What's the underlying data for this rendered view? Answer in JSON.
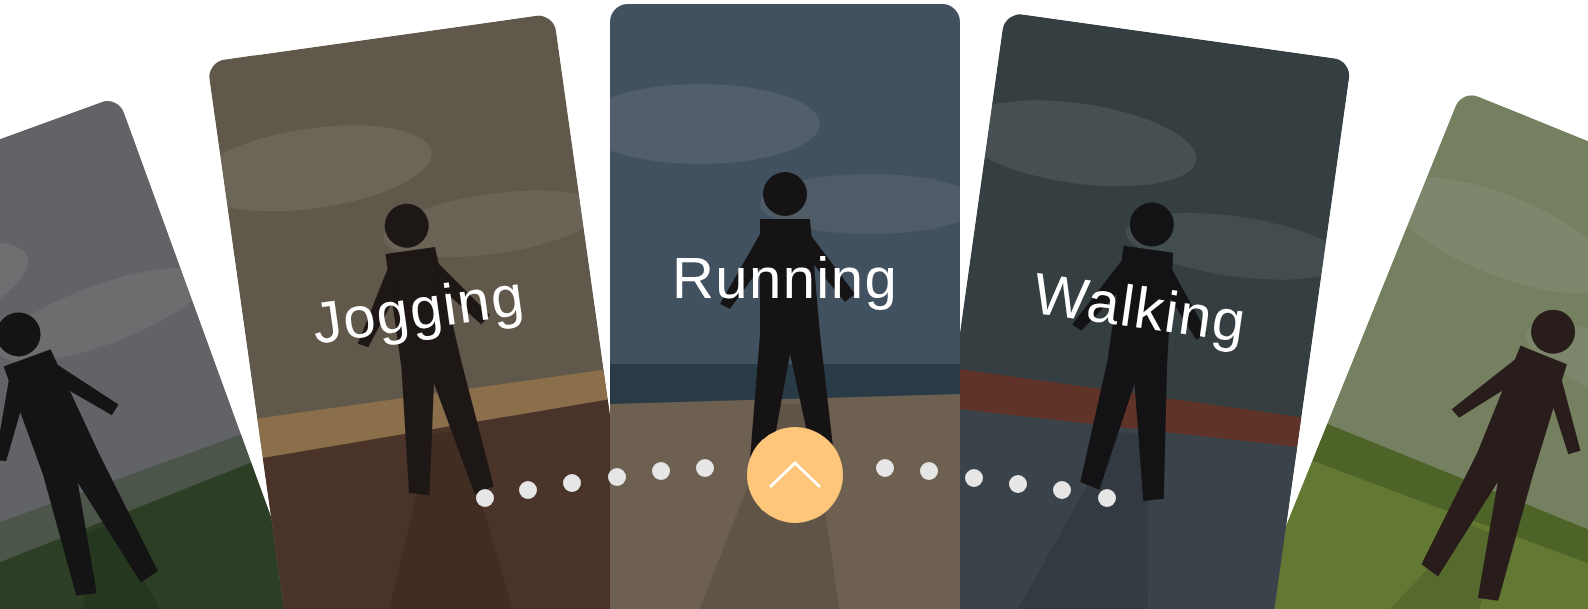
{
  "cards": [
    {
      "kind": "picture"
    },
    {
      "kind": "labeled",
      "label": "Jogging"
    },
    {
      "kind": "labeled",
      "label": "Running"
    },
    {
      "kind": "labeled",
      "label": "Walking"
    },
    {
      "kind": "picture"
    }
  ]
}
